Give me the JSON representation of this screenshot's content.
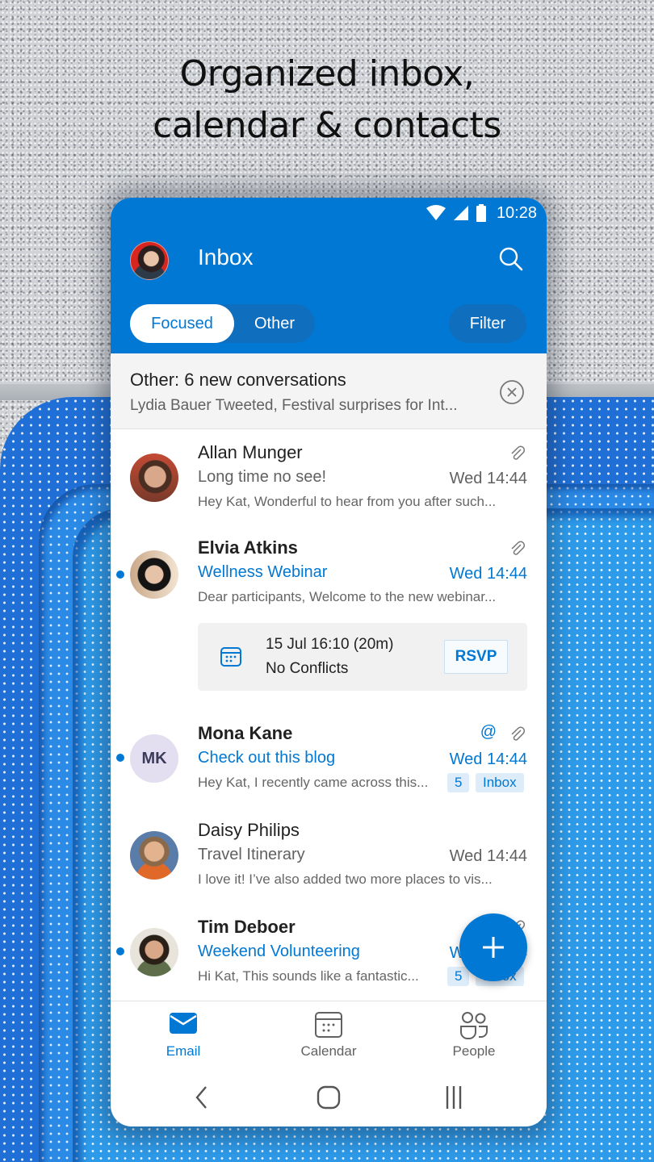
{
  "headline": {
    "line1": "Organized inbox,",
    "line2": "calendar & contacts"
  },
  "status_bar": {
    "time": "10:28",
    "icons": [
      "wifi-icon",
      "cellular-signal-icon",
      "battery-icon"
    ]
  },
  "app_bar": {
    "title": "Inbox",
    "avatar": "account-avatar",
    "search_icon": "search-icon",
    "tabs": [
      {
        "label": "Focused",
        "selected": true
      },
      {
        "label": "Other",
        "selected": false
      }
    ],
    "filter_label": "Filter"
  },
  "other_banner": {
    "title": "Other: 6 new conversations",
    "subtitle": "Lydia Bauer Tweeted, Festival surprises for Int...",
    "dismiss_icon": "close-circle-icon"
  },
  "colors": {
    "accent": "#0078d4",
    "segment_bg": "#106ebe",
    "badge_bg": "#deecf9"
  },
  "messages": [
    {
      "sender": "Allan Munger",
      "subject": "Long time no see!",
      "time": "Wed 14:44",
      "preview": "Hey Kat, Wonderful to hear from you after such...",
      "unread": false,
      "has_attachment": true
    },
    {
      "sender": "Elvia Atkins",
      "subject": "Wellness Webinar",
      "time": "Wed 14:44",
      "preview": "Dear participants, Welcome to the new webinar...",
      "unread": true,
      "has_attachment": true,
      "event": {
        "when": "15 Jul 16:10 (20m)",
        "conflicts": "No Conflicts",
        "rsvp_label": "RSVP"
      }
    },
    {
      "sender": "Mona Kane",
      "initials": "MK",
      "subject": "Check out this blog",
      "time": "Wed 14:44",
      "preview": "Hey Kat, I recently came across this...",
      "unread": true,
      "has_attachment": true,
      "mention": "@",
      "thread_count": "5",
      "folder_badge": "Inbox"
    },
    {
      "sender": "Daisy Philips",
      "subject": "Travel Itinerary",
      "time": "Wed 14:44",
      "preview": "I love it! I’ve also added two more places to vis...",
      "unread": false,
      "has_attachment": false
    },
    {
      "sender": "Tim Deboer",
      "subject": "Weekend Volunteering",
      "time": "Wed 14:44",
      "preview": "Hi Kat, This sounds like a fantastic...",
      "unread": true,
      "has_attachment": true,
      "thread_count": "5",
      "folder_badge": "Inbox"
    }
  ],
  "fab": {
    "icon": "plus-icon"
  },
  "bottom_nav": [
    {
      "label": "Email",
      "icon": "mail-icon",
      "active": true
    },
    {
      "label": "Calendar",
      "icon": "calendar-icon",
      "active": false
    },
    {
      "label": "People",
      "icon": "people-icon",
      "active": false
    }
  ],
  "system_nav": [
    "back-icon",
    "home-icon",
    "recents-icon"
  ]
}
